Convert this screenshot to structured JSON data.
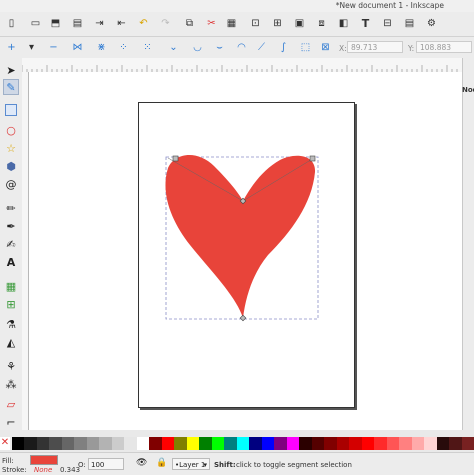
{
  "window": {
    "title": "*New document 1 - Inkscape"
  },
  "toolbar_icons": [
    "new-doc-icon",
    "open-icon",
    "save-icon",
    "print-icon",
    "import-icon",
    "export-icon",
    "undo-icon",
    "redo-icon",
    "copy-icon",
    "cut-icon",
    "paste-icon",
    "zoom-selection-icon",
    "zoom-drawing-icon",
    "zoom-page-icon",
    "duplicate-icon",
    "clone-icon",
    "unlink-clone-icon",
    "group-icon",
    "ungroup-icon",
    "fill-stroke-icon",
    "text-font-icon",
    "align-icon",
    "xml-editor-icon",
    "preferences-icon"
  ],
  "node_toolbar": {
    "x_label": "X:",
    "x_value": "89.713",
    "y_label": "Y:",
    "y_value": "108.883"
  },
  "right_dock": {
    "label": "Nod"
  },
  "tools": [
    "selector-tool-icon",
    "node-tool-icon",
    "zoom-tool-icon",
    "rect-tool-icon",
    "circle-tool-icon",
    "star-tool-icon",
    "3dbox-tool-icon",
    "spiral-tool-icon",
    "pencil-tool-icon",
    "pen-tool-icon",
    "calligraphy-tool-icon",
    "text-tool-icon",
    "gradient-tool-icon",
    "mesh-tool-icon",
    "dropper-tool-icon",
    "paint-bucket-icon",
    "tweak-tool-icon",
    "spray-tool-icon",
    "eraser-tool-icon",
    "connector-tool-icon"
  ],
  "colors": {
    "heart_fill": "#e8443a",
    "accent": "#2f7bd3"
  },
  "palette": [
    "#000000",
    "#1a1a1a",
    "#333333",
    "#4d4d4d",
    "#666666",
    "#808080",
    "#999999",
    "#b3b3b3",
    "#cccccc",
    "#e6e6e6",
    "#ffffff",
    "#800000",
    "#ff0000",
    "#808000",
    "#ffff00",
    "#008000",
    "#00ff00",
    "#008080",
    "#00ffff",
    "#000080",
    "#0000ff",
    "#800080",
    "#ff00ff",
    "#2b0000",
    "#550000",
    "#800000",
    "#aa0000",
    "#d40000",
    "#ff0000",
    "#ff2a2a",
    "#ff5555",
    "#ff8080",
    "#ffaaaa",
    "#ffd5d5",
    "#280b0b",
    "#501616",
    "#782121"
  ],
  "status": {
    "fill_label": "Fill:",
    "stroke_label": "Stroke:",
    "stroke_value": "None",
    "stroke_width": "0.343",
    "opacity_label": "O:",
    "opacity_value": "100",
    "layer": "•Layer 1",
    "hint_bold": "Shift:",
    "hint": "click to toggle segment selection"
  }
}
